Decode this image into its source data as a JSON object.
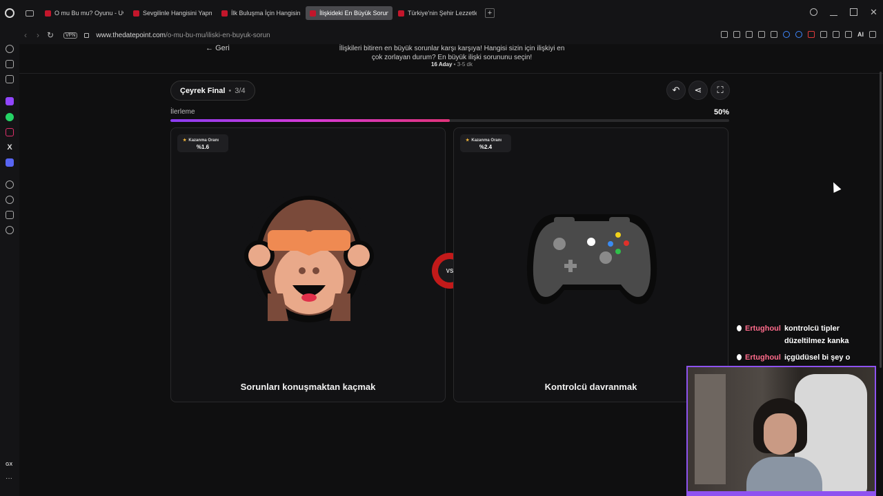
{
  "browser": {
    "tabs": [
      {
        "title": "O mu Bu mu? Oyunu - Uw",
        "active": false
      },
      {
        "title": "Sevgilinle Hangisini Yapm",
        "active": false
      },
      {
        "title": "İlk Buluşma İçin Hangisini",
        "active": false
      },
      {
        "title": "İlişkideki En Büyük Sorun",
        "active": true
      },
      {
        "title": "Türkiye'nin Şehir Lezzetle",
        "active": false
      }
    ],
    "new_tab": "+",
    "vpn_label": "VPN",
    "url_domain": "www.thedatepoint.com",
    "url_path": "/o-mu-bu-mu/iliski-en-buyuk-sorun",
    "ai_label": "AI"
  },
  "sidebar": {
    "gx_label": "GX",
    "more": "···"
  },
  "page": {
    "back_label": "Geri",
    "description": "İlişkileri bitiren en büyük sorunlar karşı karşıya! Hangisi sizin için ilişkiyi en çok zorlayan durum? En büyük ilişki sorununu seçin!",
    "candidates_count": "16 Aday",
    "duration": "3-5 dk",
    "meta_separator": "•",
    "round_name": "Çeyrek Final",
    "round_separator": "•",
    "round_count": "3/4",
    "progress_label": "İlerleme",
    "progress_value": "50%",
    "progress_fraction": 0.5,
    "vs_label": "VS",
    "cards": [
      {
        "win_label": "Kazanma Oranı",
        "win_rate": "%1.6",
        "title": "Sorunları konuşmaktan kaçmak",
        "icon": "see-no-evil-monkey-icon"
      },
      {
        "win_label": "Kazanma Oranı",
        "win_rate": "%2.4",
        "title": "Kontrolcü davranmak",
        "icon": "game-controller-icon"
      }
    ]
  },
  "chat": [
    {
      "user": "Ertughoul",
      "text": "kontrolcü tipler düzeltilmez kanka"
    },
    {
      "user": "Ertughoul",
      "text": "içgüdüsel bi şey o"
    }
  ],
  "colors": {
    "accent_red": "#c21a1a",
    "progress_start": "#8a3cf0",
    "progress_end": "#e0337a",
    "chat_user": "#ff6b8b",
    "webcam_border": "#8e52f0"
  }
}
